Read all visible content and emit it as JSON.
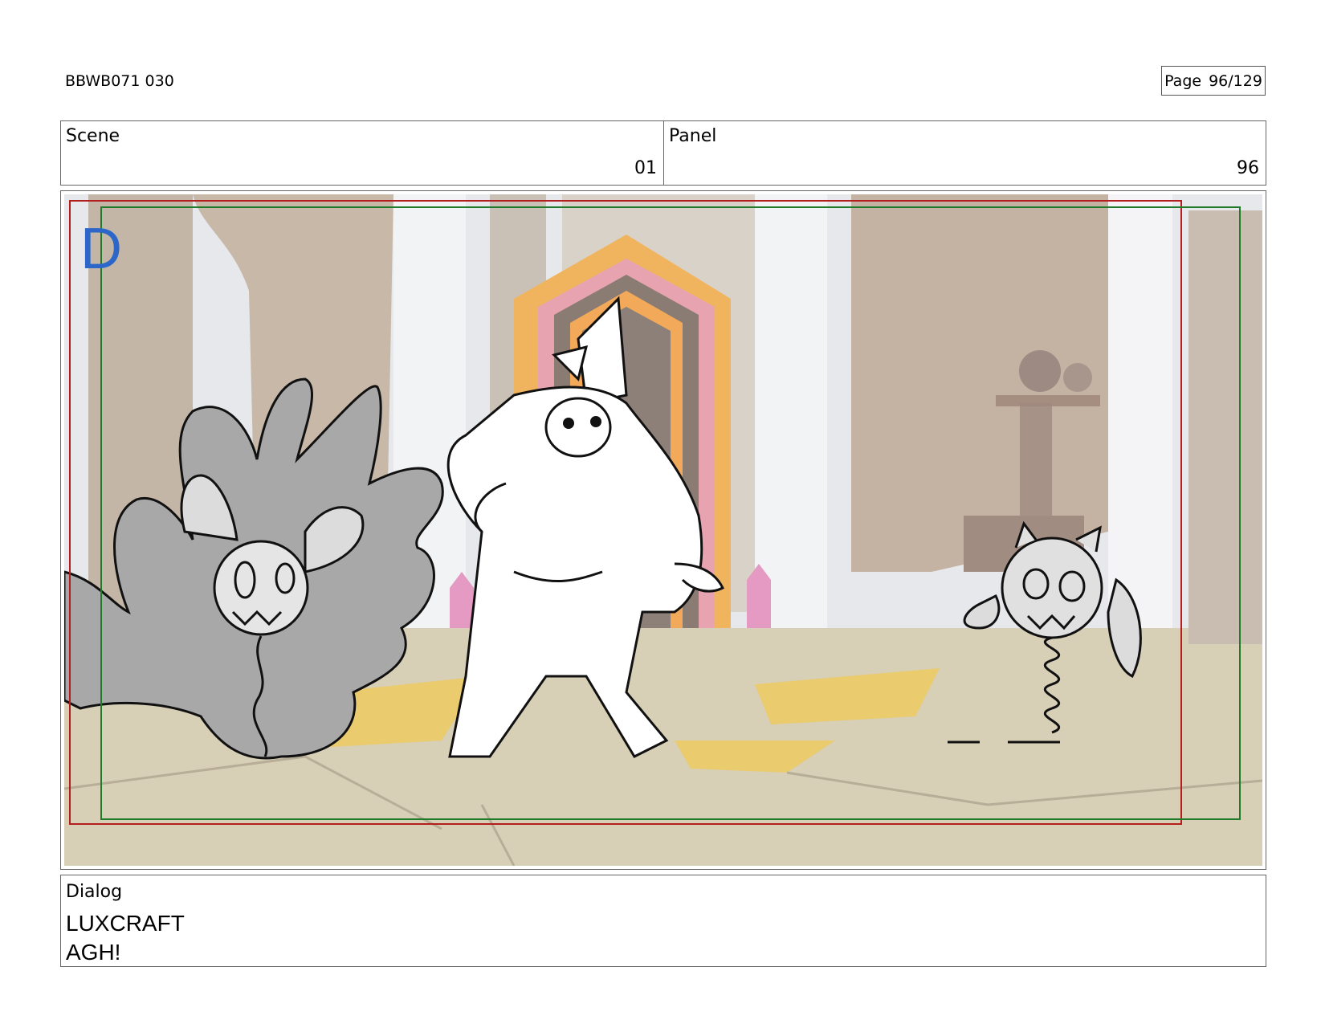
{
  "header": {
    "doc_code": "BBWB071 030",
    "page_label": "Page",
    "page_value": "96/129"
  },
  "info": {
    "scene_label": "Scene",
    "scene_value": "01",
    "panel_label": "Panel",
    "panel_value": "96"
  },
  "panel_art": {
    "corner_mark": "D"
  },
  "dialog": {
    "label": "Dialog",
    "speaker": "LUXCRAFT",
    "line": "AGH!"
  }
}
